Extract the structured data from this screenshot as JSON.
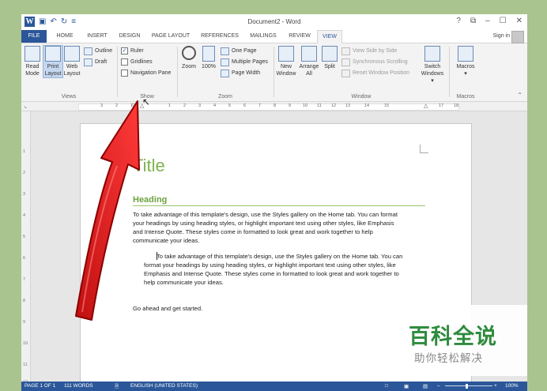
{
  "window": {
    "title": "Document2 - Word",
    "controls": [
      "?",
      "⧉",
      "–",
      "☐",
      "✕"
    ]
  },
  "qat": {
    "save_icon": "floppy-icon",
    "undo": "↶",
    "redo": "↻",
    "customize": "≡"
  },
  "tabs": [
    "FILE",
    "HOME",
    "INSERT",
    "DESIGN",
    "PAGE LAYOUT",
    "REFERENCES",
    "MAILINGS",
    "REVIEW",
    "VIEW"
  ],
  "active_tab": "VIEW",
  "sign_in": "Sign in",
  "ribbon": {
    "views": {
      "label": "Views",
      "read_mode": [
        "Read",
        "Mode"
      ],
      "print_layout": [
        "Print",
        "Layout"
      ],
      "web_layout": [
        "Web",
        "Layout"
      ],
      "outline": "Outline",
      "draft": "Draft"
    },
    "show": {
      "label": "Show",
      "ruler": "Ruler",
      "gridlines": "Gridlines",
      "navigation_pane": "Navigation Pane",
      "ruler_checked": true
    },
    "zoom": {
      "label": "Zoom",
      "zoom": "Zoom",
      "hundred": "100%",
      "one_page": "One Page",
      "multiple_pages": "Multiple Pages",
      "page_width": "Page Width"
    },
    "window": {
      "label": "Window",
      "new_window": [
        "New",
        "Window"
      ],
      "arrange_all": [
        "Arrange",
        "All"
      ],
      "split": "Split",
      "view_side_by_side": "View Side by Side",
      "sync_scrolling": "Synchronous Scrolling",
      "reset_position": "Reset Window Position",
      "switch_windows": [
        "Switch",
        "Windows ▾"
      ]
    },
    "macros": {
      "label": "Macros",
      "macros": "Macros",
      "dropdown": "▾"
    }
  },
  "ruler_ticks": [
    "3",
    "2",
    "1",
    "1",
    "2",
    "3",
    "4",
    "5",
    "6",
    "7",
    "8",
    "9",
    "10",
    "11",
    "12",
    "13",
    "14",
    "15",
    "17",
    "18"
  ],
  "vruler_ticks": [
    "1",
    "2",
    "3",
    "4",
    "5",
    "6",
    "7",
    "8",
    "9",
    "10",
    "11",
    "12"
  ],
  "document": {
    "title": "Title",
    "heading": "Heading",
    "para1": [
      "To take advantage of this template's design, use the Styles gallery on the Home tab. You can format",
      "your headings by using heading styles, or highlight important text using other styles, like Emphasis",
      "and Intense Quote. These styles come in formatted to look great and work together to help",
      "communicate your ideas."
    ],
    "para2": [
      "To take advantage of this template's design, use the Styles gallery on the Home tab. You can",
      "format your headings by using heading styles, or highlight important text using other styles, like",
      "Emphasis and Intense Quote. These styles come in formatted to look great and work together to",
      "help communicate your ideas."
    ],
    "para3": "Go ahead and get started."
  },
  "status": {
    "page": "PAGE 1 OF 1",
    "words": "111 WORDS",
    "proof_icon": "proofing-icon",
    "language": "ENGLISH (UNITED STATES)",
    "zoom_minus": "–",
    "zoom_plus": "+",
    "zoom": "100%"
  },
  "watermark": {
    "main": "百科全说",
    "sub": "助你轻松解决"
  },
  "colors": {
    "word_blue": "#2b579a",
    "heading_green": "#7fb24f",
    "arrow_red": "#e02020"
  }
}
